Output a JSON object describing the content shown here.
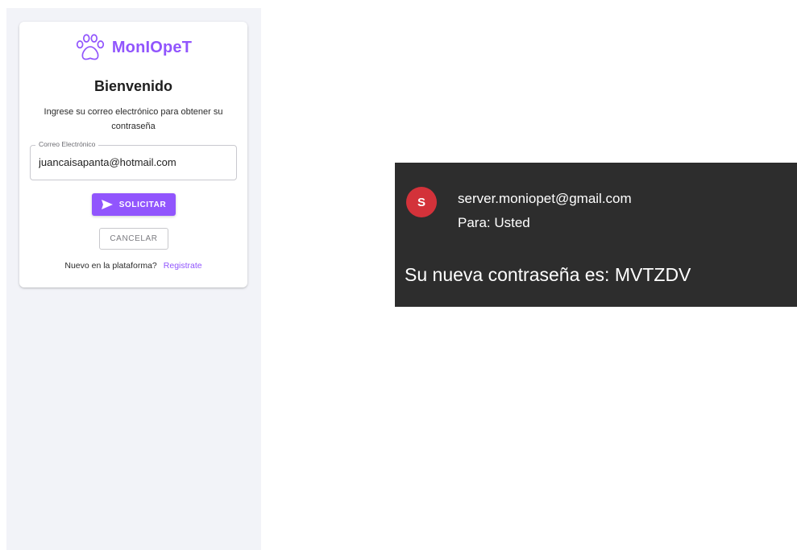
{
  "login_card": {
    "brand_name": "MonIOpeT",
    "brand_icon": "paw-icon",
    "title": "Bienvenido",
    "subtitle": "Ingrese su correo electrónico para obtener su contraseña",
    "email_field": {
      "label": "Correo Electrónico",
      "value": "juancaisapanta@hotmail.com"
    },
    "submit_label": "SOLICITAR",
    "submit_icon": "send-icon",
    "cancel_label": "CANCELAR",
    "footer_text": "Nuevo en la plataforma?",
    "register_link": "Registrate",
    "accent_color": "#9155fd"
  },
  "email_preview": {
    "avatar_initial": "S",
    "avatar_color": "#d3323a",
    "sender": "server.moniopet@gmail.com",
    "to_line": "Para: Usted",
    "body": "Su nueva contraseña es: MVTZDV"
  }
}
